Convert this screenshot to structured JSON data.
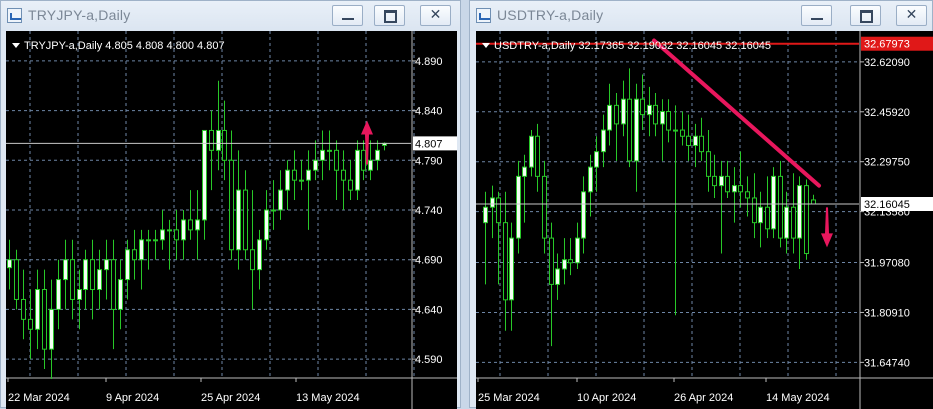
{
  "window_left": {
    "title": "TRYJPY-a,Daily",
    "buttons": {
      "minimize": "minimize-icon",
      "maximize": "maximize-icon",
      "close": "close-icon"
    }
  },
  "window_right": {
    "title": "USDTRY-a,Daily",
    "buttons": {
      "minimize": "minimize-icon",
      "maximize": "maximize-icon",
      "close": "close-icon"
    }
  },
  "colors": {
    "background": "#000000",
    "candle": "#28c828",
    "bull_body": "#f4fff4",
    "grid": "#6e86a6",
    "price_line": "#c8c8c8",
    "trendline": "#e8175d",
    "arrow": "#e8175d",
    "ask_line": "#e01818"
  },
  "chart_data": [
    {
      "type": "candlestick",
      "symbol_line": "TRYJPY-a,Daily  4.805 4.808 4.800 4.807",
      "y_ticks": [
        "4.890",
        "4.840",
        "4.790",
        "4.740",
        "4.690",
        "4.640",
        "4.590"
      ],
      "y_tick_values": [
        4.89,
        4.84,
        4.79,
        4.74,
        4.69,
        4.64,
        4.59
      ],
      "x_ticks": [
        "22 Mar 2024",
        "9 Apr 2024",
        "25 Apr 2024",
        "13 May 2024"
      ],
      "ylim": [
        4.572,
        4.912
      ],
      "grid": true,
      "current_price": 4.807,
      "current_price_label": "4.807",
      "arrow": "up",
      "candles": [
        [
          4.682,
          4.71,
          4.66,
          4.69
        ],
        [
          4.69,
          4.7,
          4.64,
          4.65
        ],
        [
          4.65,
          4.68,
          4.61,
          4.63
        ],
        [
          4.63,
          4.66,
          4.59,
          4.62
        ],
        [
          4.62,
          4.68,
          4.6,
          4.66
        ],
        [
          4.66,
          4.68,
          4.58,
          4.6
        ],
        [
          4.6,
          4.67,
          4.57,
          4.64
        ],
        [
          4.64,
          4.69,
          4.62,
          4.67
        ],
        [
          4.67,
          4.71,
          4.64,
          4.69
        ],
        [
          4.69,
          4.71,
          4.63,
          4.65
        ],
        [
          4.65,
          4.68,
          4.62,
          4.66
        ],
        [
          4.66,
          4.7,
          4.64,
          4.69
        ],
        [
          4.69,
          4.71,
          4.63,
          4.66
        ],
        [
          4.66,
          4.7,
          4.64,
          4.68
        ],
        [
          4.68,
          4.71,
          4.65,
          4.69
        ],
        [
          4.69,
          4.71,
          4.6,
          4.64
        ],
        [
          4.64,
          4.69,
          4.62,
          4.67
        ],
        [
          4.67,
          4.71,
          4.65,
          4.7
        ],
        [
          4.7,
          4.72,
          4.67,
          4.69
        ],
        [
          4.69,
          4.72,
          4.66,
          4.71
        ],
        [
          4.71,
          4.72,
          4.68,
          4.71
        ],
        [
          4.71,
          4.72,
          4.69,
          4.71
        ],
        [
          4.71,
          4.74,
          4.7,
          4.72
        ],
        [
          4.72,
          4.73,
          4.68,
          4.72
        ],
        [
          4.72,
          4.74,
          4.69,
          4.71
        ],
        [
          4.71,
          4.74,
          4.69,
          4.73
        ],
        [
          4.73,
          4.76,
          4.71,
          4.72
        ],
        [
          4.72,
          4.76,
          4.69,
          4.73
        ],
        [
          4.73,
          4.79,
          4.71,
          4.82
        ],
        [
          4.82,
          4.84,
          4.76,
          4.8
        ],
        [
          4.8,
          4.87,
          4.78,
          4.82
        ],
        [
          4.82,
          4.85,
          4.77,
          4.79
        ],
        [
          4.79,
          4.82,
          4.69,
          4.7
        ],
        [
          4.7,
          4.8,
          4.68,
          4.76
        ],
        [
          4.76,
          4.78,
          4.69,
          4.7
        ],
        [
          4.7,
          4.76,
          4.64,
          4.68
        ],
        [
          4.68,
          4.72,
          4.66,
          4.71
        ],
        [
          4.71,
          4.76,
          4.7,
          4.74
        ],
        [
          4.74,
          4.77,
          4.72,
          4.74
        ],
        [
          4.74,
          4.78,
          4.73,
          4.76
        ],
        [
          4.76,
          4.79,
          4.74,
          4.78
        ],
        [
          4.78,
          4.8,
          4.75,
          4.77
        ],
        [
          4.77,
          4.79,
          4.76,
          4.77
        ],
        [
          4.77,
          4.8,
          4.72,
          4.78
        ],
        [
          4.78,
          4.81,
          4.77,
          4.79
        ],
        [
          4.79,
          4.82,
          4.77,
          4.8
        ],
        [
          4.8,
          4.82,
          4.78,
          4.8
        ],
        [
          4.8,
          4.81,
          4.75,
          4.78
        ],
        [
          4.78,
          4.8,
          4.74,
          4.77
        ],
        [
          4.77,
          4.79,
          4.75,
          4.76
        ],
        [
          4.76,
          4.81,
          4.75,
          4.8
        ],
        [
          4.8,
          4.81,
          4.77,
          4.78
        ],
        [
          4.78,
          4.81,
          4.77,
          4.79
        ],
        [
          4.79,
          4.81,
          4.78,
          4.8
        ],
        [
          4.805,
          4.808,
          4.8,
          4.807
        ]
      ]
    },
    {
      "type": "candlestick",
      "symbol_line": "USDTRY-a,Daily  32.17365 32.19032 32.16045 32.16045",
      "y_ticks": [
        "32.62090",
        "32.45920",
        "32.29750",
        "32.13580",
        "31.97080",
        "31.80910",
        "31.64740"
      ],
      "y_tick_values": [
        32.6209,
        32.4592,
        32.2975,
        32.1358,
        31.9708,
        31.8091,
        31.6474
      ],
      "x_ticks": [
        "25 Mar 2024",
        "10 Apr 2024",
        "26 Apr 2024",
        "14 May 2024"
      ],
      "ylim": [
        31.6,
        32.695
      ],
      "grid": true,
      "current_price": 32.16045,
      "current_price_label": "32.16045",
      "ask_price": 32.67973,
      "ask_label": "32.67973",
      "arrow": "down",
      "trendline": [
        [
          32.69,
          32.22
        ]
      ],
      "candles": [
        [
          32.1,
          32.2,
          31.9,
          32.15
        ],
        [
          32.15,
          32.22,
          32.05,
          32.18
        ],
        [
          32.18,
          32.2,
          31.9,
          32.1
        ],
        [
          32.1,
          32.2,
          31.75,
          31.85
        ],
        [
          31.85,
          32.1,
          31.75,
          32.05
        ],
        [
          32.05,
          32.3,
          32.0,
          32.25
        ],
        [
          32.25,
          32.32,
          32.1,
          32.28
        ],
        [
          32.28,
          32.4,
          32.25,
          32.38
        ],
        [
          32.38,
          32.42,
          32.2,
          32.25
        ],
        [
          32.25,
          32.3,
          32.0,
          32.05
        ],
        [
          32.05,
          32.1,
          31.7,
          31.9
        ],
        [
          31.9,
          32.0,
          31.85,
          31.95
        ],
        [
          31.95,
          32.05,
          31.9,
          31.98
        ],
        [
          31.98,
          32.05,
          31.93,
          31.97
        ],
        [
          31.97,
          32.1,
          31.95,
          32.05
        ],
        [
          32.05,
          32.25,
          32.0,
          32.2
        ],
        [
          32.2,
          32.32,
          32.12,
          32.28
        ],
        [
          32.28,
          32.38,
          32.2,
          32.33
        ],
        [
          32.33,
          32.45,
          32.28,
          32.4
        ],
        [
          32.4,
          32.55,
          32.35,
          32.48
        ],
        [
          32.48,
          32.52,
          32.3,
          32.42
        ],
        [
          32.42,
          32.56,
          32.38,
          32.5
        ],
        [
          32.5,
          32.6,
          32.28,
          32.3
        ],
        [
          32.3,
          32.55,
          32.2,
          32.5
        ],
        [
          32.5,
          32.58,
          32.4,
          32.45
        ],
        [
          32.45,
          32.54,
          32.38,
          32.48
        ],
        [
          32.48,
          32.52,
          32.38,
          32.42
        ],
        [
          32.42,
          32.5,
          32.3,
          32.46
        ],
        [
          32.46,
          32.5,
          32.36,
          32.4
        ],
        [
          32.4,
          32.48,
          31.8,
          32.4
        ],
        [
          32.4,
          32.46,
          32.35,
          32.38
        ],
        [
          32.38,
          32.45,
          32.3,
          32.35
        ],
        [
          32.35,
          32.42,
          32.28,
          32.38
        ],
        [
          32.38,
          32.44,
          32.3,
          32.33
        ],
        [
          32.33,
          32.4,
          32.2,
          32.25
        ],
        [
          32.25,
          32.32,
          32.18,
          32.22
        ],
        [
          32.22,
          32.3,
          32.0,
          32.25
        ],
        [
          32.25,
          32.3,
          32.18,
          32.2
        ],
        [
          32.2,
          32.28,
          32.1,
          32.22
        ],
        [
          32.22,
          32.33,
          32.15,
          32.2
        ],
        [
          32.2,
          32.25,
          32.12,
          32.18
        ],
        [
          32.18,
          32.26,
          32.05,
          32.1
        ],
        [
          32.1,
          32.2,
          32.02,
          32.15
        ],
        [
          32.15,
          32.25,
          32.05,
          32.08
        ],
        [
          32.08,
          32.28,
          32.05,
          32.25
        ],
        [
          32.25,
          32.3,
          32.02,
          32.05
        ],
        [
          32.05,
          32.2,
          32.0,
          32.15
        ],
        [
          32.15,
          32.26,
          32.0,
          32.05
        ],
        [
          32.05,
          32.25,
          31.95,
          32.22
        ],
        [
          32.22,
          32.24,
          31.98,
          32.0
        ],
        [
          32.17365,
          32.19032,
          32.16045,
          32.16045
        ]
      ]
    }
  ]
}
